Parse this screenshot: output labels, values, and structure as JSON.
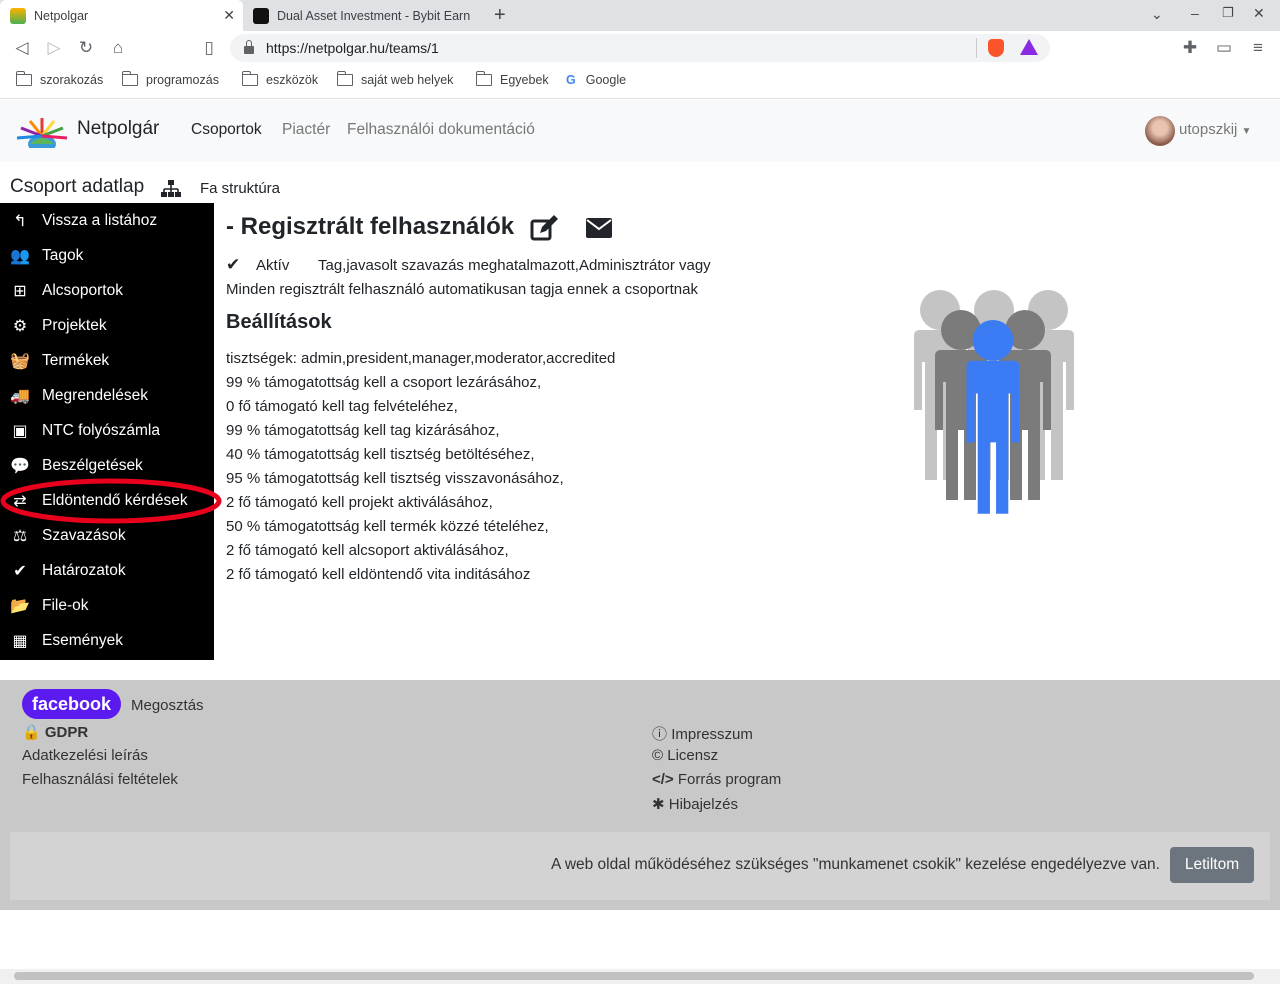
{
  "browser": {
    "tabs": [
      {
        "title": "Netpolgar"
      },
      {
        "title": "Dual Asset Investment - Bybit Earn"
      }
    ],
    "url": "https://netpolgar.hu/teams/1",
    "bookmarks": [
      "szorakozás",
      "programozás",
      "eszközök",
      "saját web helyek",
      "Egyebek",
      "Google"
    ]
  },
  "navbar": {
    "brand": "Netpolgár",
    "links": [
      "Csoportok",
      "Piactér",
      "Felhasználói dokumentáció"
    ],
    "user": "utopszkij"
  },
  "page": {
    "header": "Csoport adatlap",
    "tree_link": "Fa struktúra",
    "title": "- Regisztrált felhasználók",
    "status": "Aktív",
    "roles": "Tag,javasolt szavazás meghatalmazott,Adminisztrátor vagy",
    "description": "Minden regisztrált felhasználó automatikusan tagja ennek a csoportnak",
    "settings_title": "Beállítások",
    "settings": [
      "tisztségek: admin,president,manager,moderator,accredited",
      "99 % támogatottság kell a csoport lezárásához,",
      "0 fő támogató kell tag felvételéhez,",
      "99 % támogatottság kell tag kizárásához,",
      "40 % támogatottság kell tisztség betöltéséhez,",
      "95 % támogatottság kell tisztség visszavonásához,",
      "2 fő támogató kell projekt aktiválásához,",
      "50 % támogatottság kell termék közzé tételéhez,",
      "2 fő támogató kell alcsoport aktiválásához,",
      "2 fő támogató kell eldöntendő vita inditásához"
    ]
  },
  "sidebar": {
    "items": [
      {
        "label": "Vissza a listához",
        "icon": "reply-icon"
      },
      {
        "label": "Tagok",
        "icon": "users-icon"
      },
      {
        "label": "Alcsoportok",
        "icon": "sitemap-icon"
      },
      {
        "label": "Projektek",
        "icon": "cogs-icon"
      },
      {
        "label": "Termékek",
        "icon": "basket-icon"
      },
      {
        "label": "Megrendelések",
        "icon": "truck-icon"
      },
      {
        "label": "NTC folyószámla",
        "icon": "money-icon"
      },
      {
        "label": "Beszélgetések",
        "icon": "comments-icon"
      },
      {
        "label": "Eldöntendő kérdések",
        "icon": "retweet-icon"
      },
      {
        "label": "Szavazások",
        "icon": "balance-icon"
      },
      {
        "label": "Határozatok",
        "icon": "check-icon"
      },
      {
        "label": "File-ok",
        "icon": "folder-open-icon"
      },
      {
        "label": "Események",
        "icon": "calendar-icon"
      }
    ]
  },
  "footer": {
    "facebook": "facebook",
    "share": "Megosztás",
    "gdpr": "GDPR",
    "privacy": "Adatkezelési leírás",
    "terms": "Felhasználási feltételek",
    "impressum": "Impresszum",
    "license": "Licensz",
    "source": "Forrás program",
    "bugreport": "Hibajelzés",
    "cookie_text": "A web oldal működéséhez szükséges \"munkamenet csokik\" kezelése engedélyezve van.",
    "cookie_button": "Letiltom"
  },
  "colors": {
    "highlight_ellipse": "#e8001c",
    "person_blue": "#3b7cf5",
    "facebook_purple": "#5b1bf0"
  }
}
